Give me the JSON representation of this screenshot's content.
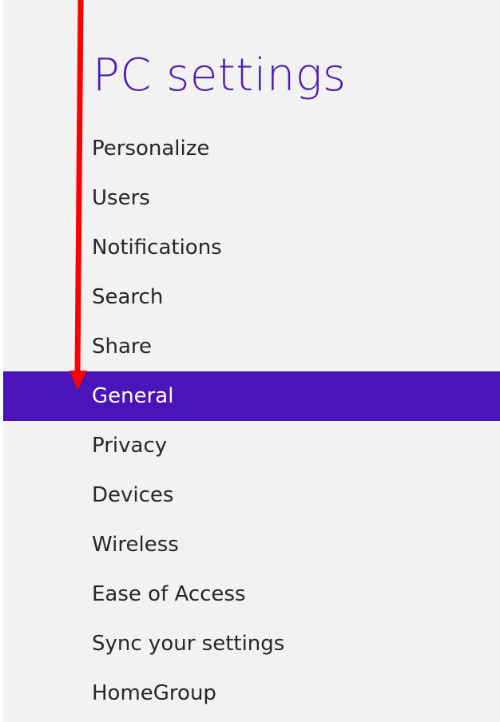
{
  "page": {
    "title": "PC settings"
  },
  "nav": {
    "items": [
      {
        "label": "Personalize"
      },
      {
        "label": "Users"
      },
      {
        "label": "Notifications"
      },
      {
        "label": "Search"
      },
      {
        "label": "Share"
      },
      {
        "label": "General",
        "selected": true
      },
      {
        "label": "Privacy"
      },
      {
        "label": "Devices"
      },
      {
        "label": "Wireless"
      },
      {
        "label": "Ease of Access"
      },
      {
        "label": "Sync your settings"
      },
      {
        "label": "HomeGroup"
      }
    ]
  },
  "colors": {
    "background": "#f3f2f3",
    "accent": "#4a14b8",
    "title": "#4d1eb3",
    "annotation_arrow": "#ff0000"
  },
  "annotation": {
    "type": "arrow",
    "points_to": "General"
  }
}
